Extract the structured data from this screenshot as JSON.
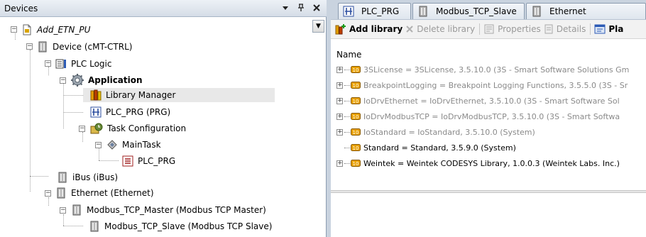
{
  "devices_panel": {
    "title": "Devices",
    "controls": {
      "menu": "▾",
      "pin": "ᵖ",
      "close": "✕"
    },
    "scroll_button": "▼",
    "tree": [
      {
        "label": "Add_ETN_PU",
        "icon": "project-icon",
        "italic": true
      },
      {
        "label": "Device (cMT-CTRL)",
        "icon": "device-icon"
      },
      {
        "label": "PLC Logic",
        "icon": "plc-logic-icon"
      },
      {
        "label": "Application",
        "icon": "application-gear-icon",
        "bold": true
      },
      {
        "label": "Library Manager",
        "icon": "library-manager-icon",
        "selected": true
      },
      {
        "label": "PLC_PRG (PRG)",
        "icon": "program-icon"
      },
      {
        "label": "Task Configuration",
        "icon": "task-configuration-icon"
      },
      {
        "label": "MainTask",
        "icon": "task-icon"
      },
      {
        "label": "PLC_PRG",
        "icon": "program-call-icon"
      },
      {
        "label": "iBus (iBus)",
        "icon": "device-icon"
      },
      {
        "label": "Ethernet (Ethernet)",
        "icon": "device-icon"
      },
      {
        "label": "Modbus_TCP_Master (Modbus TCP Master)",
        "icon": "device-icon"
      },
      {
        "label": "Modbus_TCP_Slave (Modbus TCP Slave)",
        "icon": "device-icon"
      }
    ]
  },
  "editor_tabs": [
    {
      "label": "PLC_PRG",
      "icon": "program-icon"
    },
    {
      "label": "Modbus_TCP_Slave",
      "icon": "device-icon"
    },
    {
      "label": "Ethernet",
      "icon": "device-icon"
    }
  ],
  "toolbar": {
    "add_library": "Add library",
    "delete_library": "Delete library",
    "properties": "Properties",
    "details": "Details",
    "placeholder": "Pla"
  },
  "library_list": {
    "column_header": "Name",
    "rows": [
      {
        "text": "3SLicense = 3SLicense, 3.5.10.0 (3S - Smart Software Solutions Gm",
        "expandable": true,
        "active": false
      },
      {
        "text": "BreakpointLogging = Breakpoint Logging Functions, 3.5.5.0 (3S - Sr",
        "expandable": true,
        "active": false
      },
      {
        "text": "IoDrvEthernet = IoDrvEthernet, 3.5.10.0 (3S - Smart Software Sol",
        "expandable": true,
        "active": false
      },
      {
        "text": "IoDrvModbusTCP = IoDrvModbusTCP, 3.5.10.0 (3S - Smart Softwa",
        "expandable": true,
        "active": false
      },
      {
        "text": "IoStandard = IoStandard, 3.5.10.0 (System)",
        "expandable": true,
        "active": false
      },
      {
        "text": "Standard = Standard, 3.5.9.0 (System)",
        "expandable": false,
        "active": true
      },
      {
        "text": "Weintek = Weintek CODESYS Library, 1.0.0.3 (Weintek Labs. Inc.)",
        "expandable": true,
        "active": true
      }
    ]
  },
  "colors": {
    "selection": "#e8e8e8",
    "disabled_text": "#8a8a8a",
    "panel_header": "#d5dde7",
    "library_icon": "#e8a000"
  }
}
